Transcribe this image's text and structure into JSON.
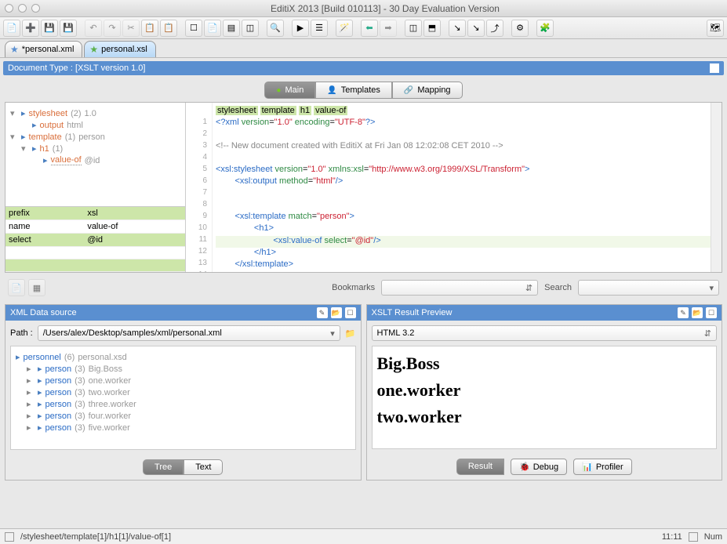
{
  "window": {
    "title": "EditiX 2013 [Build 010113] - 30 Day Evaluation Version"
  },
  "tabs": [
    {
      "label": "*personal.xml",
      "active": false
    },
    {
      "label": "personal.xsl",
      "active": true
    }
  ],
  "docTypeBar": "Document Type : [XSLT version 1.0]",
  "subtabs": {
    "main": "Main",
    "templates": "Templates",
    "mapping": "Mapping"
  },
  "tree": {
    "n0": {
      "name": "stylesheet",
      "count": "(2)",
      "tail": "1.0"
    },
    "n1": {
      "name": "output",
      "tail": "html"
    },
    "n2": {
      "name": "template",
      "count": "(1)",
      "tail": "person"
    },
    "n3": {
      "name": "h1",
      "count": "(1)"
    },
    "n4": {
      "name": "value-of",
      "tail": "@id"
    }
  },
  "props": {
    "h_prefix": "prefix",
    "v_prefix": "xsl",
    "h_name": "name",
    "v_name": "value-of",
    "h_select": "select",
    "v_select": "@id"
  },
  "breadcrumb": [
    "stylesheet",
    "template",
    "h1",
    "value-of"
  ],
  "code": {
    "l1": "<?xml version=\"1.0\" encoding=\"UTF-8\"?>",
    "l3": "<!-- New document created with EditiX at Fri Jan 08 12:02:08 CET 2010 -->",
    "l5_a": "<xsl:stylesheet ",
    "l5_b": "version",
    "l5_c": "=\"1.0\" ",
    "l5_d": "xmlns:xsl",
    "l5_e": "=\"http://www.w3.org/1999/XSL/Transform\">",
    "l6_a": "        <xsl:output ",
    "l6_b": "method",
    "l6_c": "=\"html\"/>",
    "l9_a": "        <xsl:template ",
    "l9_b": "match",
    "l9_c": "=\"person\">",
    "l10": "                <h1>",
    "l11_a": "                        <xsl:value-of ",
    "l11_b": "select",
    "l11_c": "=\"@id\"/>",
    "l12": "                </h1>",
    "l13": "        </xsl:template>"
  },
  "bookmarks": {
    "label": "Bookmarks",
    "search": "Search"
  },
  "dataSource": {
    "title": "XML Data source",
    "pathLabel": "Path :",
    "pathValue": "/Users/alex/Desktop/samples/xml/personal.xml",
    "root": {
      "name": "personnel",
      "count": "(6)",
      "tail": "personal.xsd"
    },
    "items": [
      {
        "name": "person",
        "count": "(3)",
        "tail": "Big.Boss"
      },
      {
        "name": "person",
        "count": "(3)",
        "tail": "one.worker"
      },
      {
        "name": "person",
        "count": "(3)",
        "tail": "two.worker"
      },
      {
        "name": "person",
        "count": "(3)",
        "tail": "three.worker"
      },
      {
        "name": "person",
        "count": "(3)",
        "tail": "four.worker"
      },
      {
        "name": "person",
        "count": "(3)",
        "tail": "five.worker"
      }
    ],
    "seg_tree": "Tree",
    "seg_text": "Text"
  },
  "result": {
    "title": "XSLT Result Preview",
    "format": "HTML 3.2",
    "items": [
      "Big.Boss",
      "one.worker",
      "two.worker"
    ],
    "btn_result": "Result",
    "btn_debug": "Debug",
    "btn_profiler": "Profiler"
  },
  "status": {
    "path": "/stylesheet/template[1]/h1[1]/value-of[1]",
    "pos": "11:11",
    "num": "Num"
  }
}
